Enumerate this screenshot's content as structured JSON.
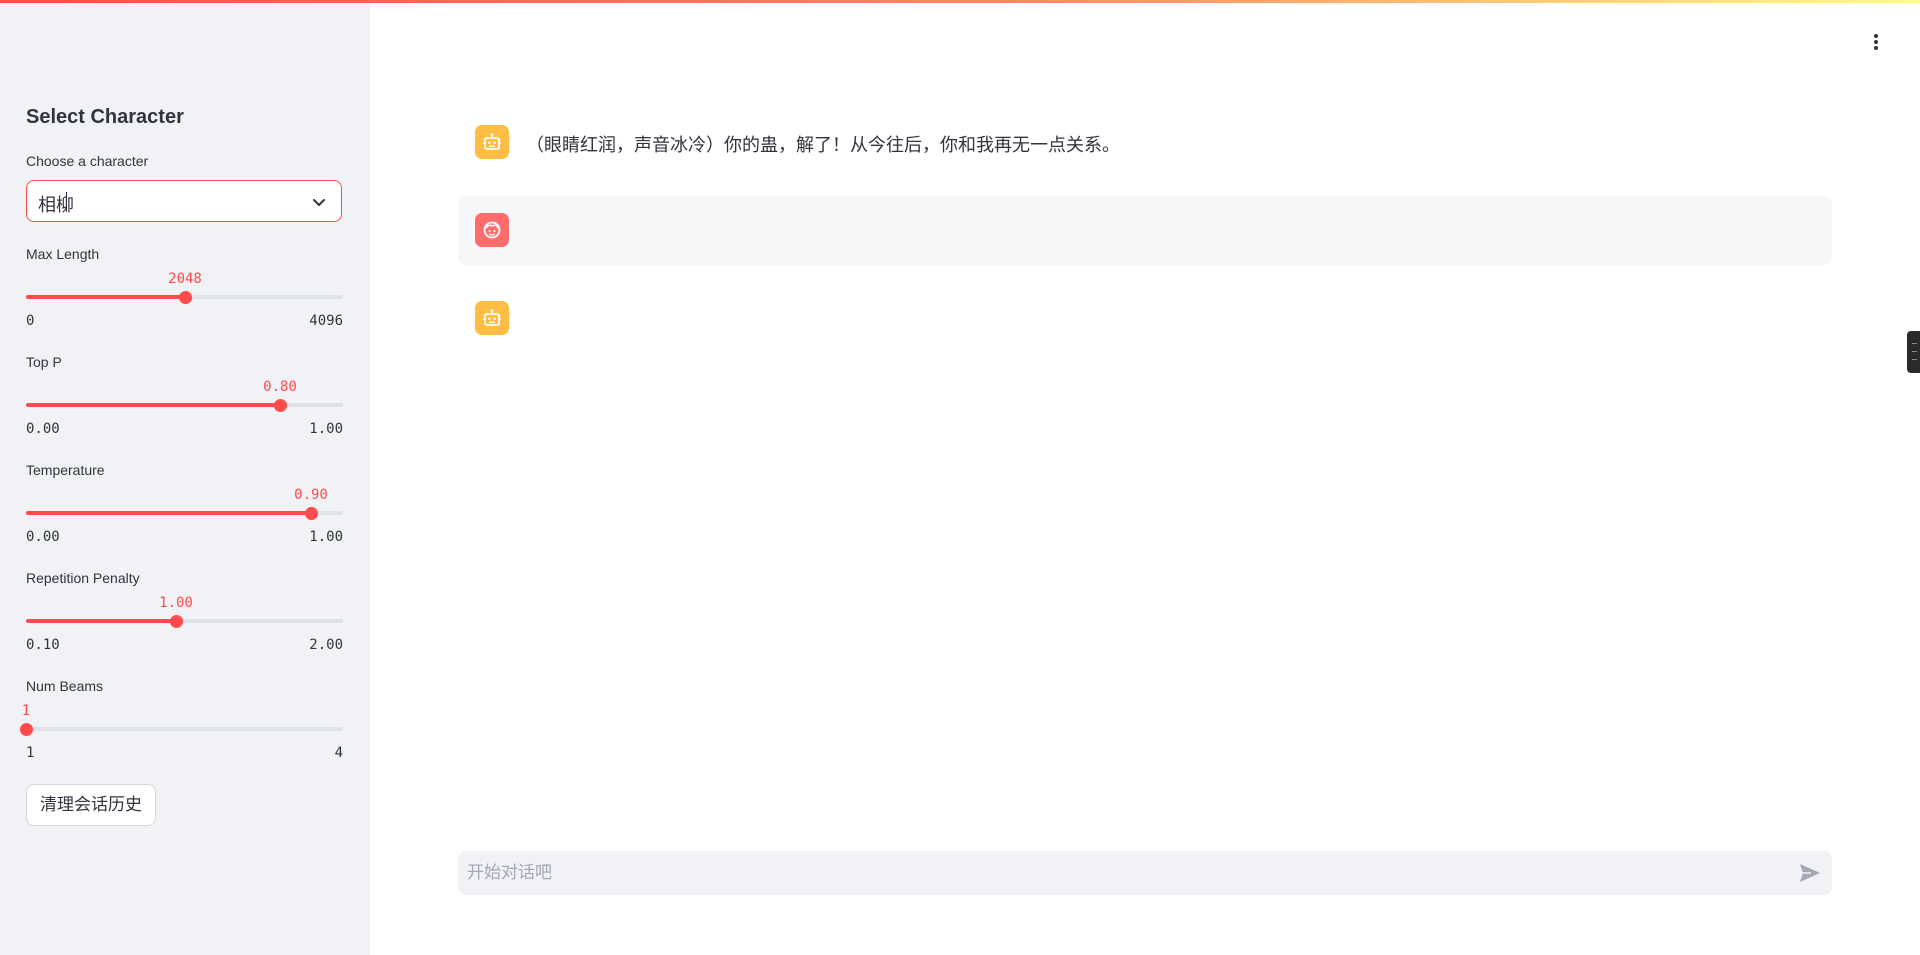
{
  "colors": {
    "accent": "#ff4b4b",
    "sidebar_bg": "#f0f2f6",
    "assistant_avatar": "#ffbd45",
    "user_avatar": "#ff6c6c"
  },
  "sidebar": {
    "title": "Select Character",
    "character_select": {
      "label": "Choose a character",
      "value": "相柳",
      "icon": "chevron-down-icon"
    },
    "sliders": [
      {
        "label": "Max Length",
        "value": 2048,
        "display": "2048",
        "min": "0",
        "max": "4096",
        "fraction": 0.5
      },
      {
        "label": "Top P",
        "value": 0.8,
        "display": "0.80",
        "min": "0.00",
        "max": "1.00",
        "fraction": 0.8
      },
      {
        "label": "Temperature",
        "value": 0.9,
        "display": "0.90",
        "min": "0.00",
        "max": "1.00",
        "fraction": 0.9
      },
      {
        "label": "Repetition Penalty",
        "value": 1.0,
        "display": "1.00",
        "min": "0.10",
        "max": "2.00",
        "fraction": 0.4737
      },
      {
        "label": "Num Beams",
        "value": 1,
        "display": "1",
        "min": "1",
        "max": "4",
        "fraction": 0
      }
    ],
    "clear_button": "清理会话历史"
  },
  "header": {
    "menu_icon": "kebab-menu-icon"
  },
  "chat": {
    "messages": [
      {
        "role": "assistant",
        "avatar_icon": "bot-icon",
        "text": "（眼睛红润，声音冰冷）你的蛊，解了！从今往后，你和我再无一点关系。"
      },
      {
        "role": "user",
        "avatar_icon": "user-face-icon",
        "text": ""
      },
      {
        "role": "assistant",
        "avatar_icon": "bot-icon",
        "text": ""
      }
    ],
    "input": {
      "placeholder": "开始对话吧",
      "value": "",
      "send_icon": "send-icon"
    }
  }
}
